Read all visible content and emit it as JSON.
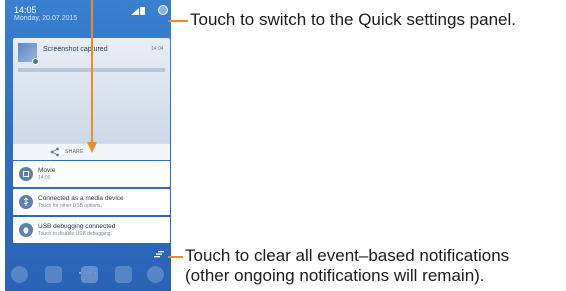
{
  "status_bar": {
    "time": "14:05",
    "date": "Monday, 20.07.2015",
    "icons": [
      "signal-icon",
      "battery-icon",
      "quick-settings-icon"
    ]
  },
  "screenshot_notification": {
    "title": "Screenshot captured",
    "time": "14:04",
    "action_label": "SHARE"
  },
  "notifications": [
    {
      "icon": "calendar-icon",
      "title": "Movie",
      "subtitle": "14:00"
    },
    {
      "icon": "usb-icon",
      "title": "Connected as a media device",
      "subtitle": "Touch for other USB options."
    },
    {
      "icon": "bug-icon",
      "title": "USB debugging connected",
      "subtitle": "Touch to disable USB debugging."
    }
  ],
  "clear_all_icon": "clear-all-icon",
  "dock": [
    "phone-icon",
    "contacts-icon",
    "apps-icon",
    "messages-icon",
    "browser-icon"
  ],
  "callouts": {
    "top": "Touch to switch to the Quick settings panel.",
    "bottom_line1": "Touch to clear all event–based notifications",
    "bottom_line2": "(other ongoing notifications will remain)."
  },
  "colors": {
    "accent_arrow": "#f08a24",
    "panel_bg": "#2f6fc4"
  }
}
